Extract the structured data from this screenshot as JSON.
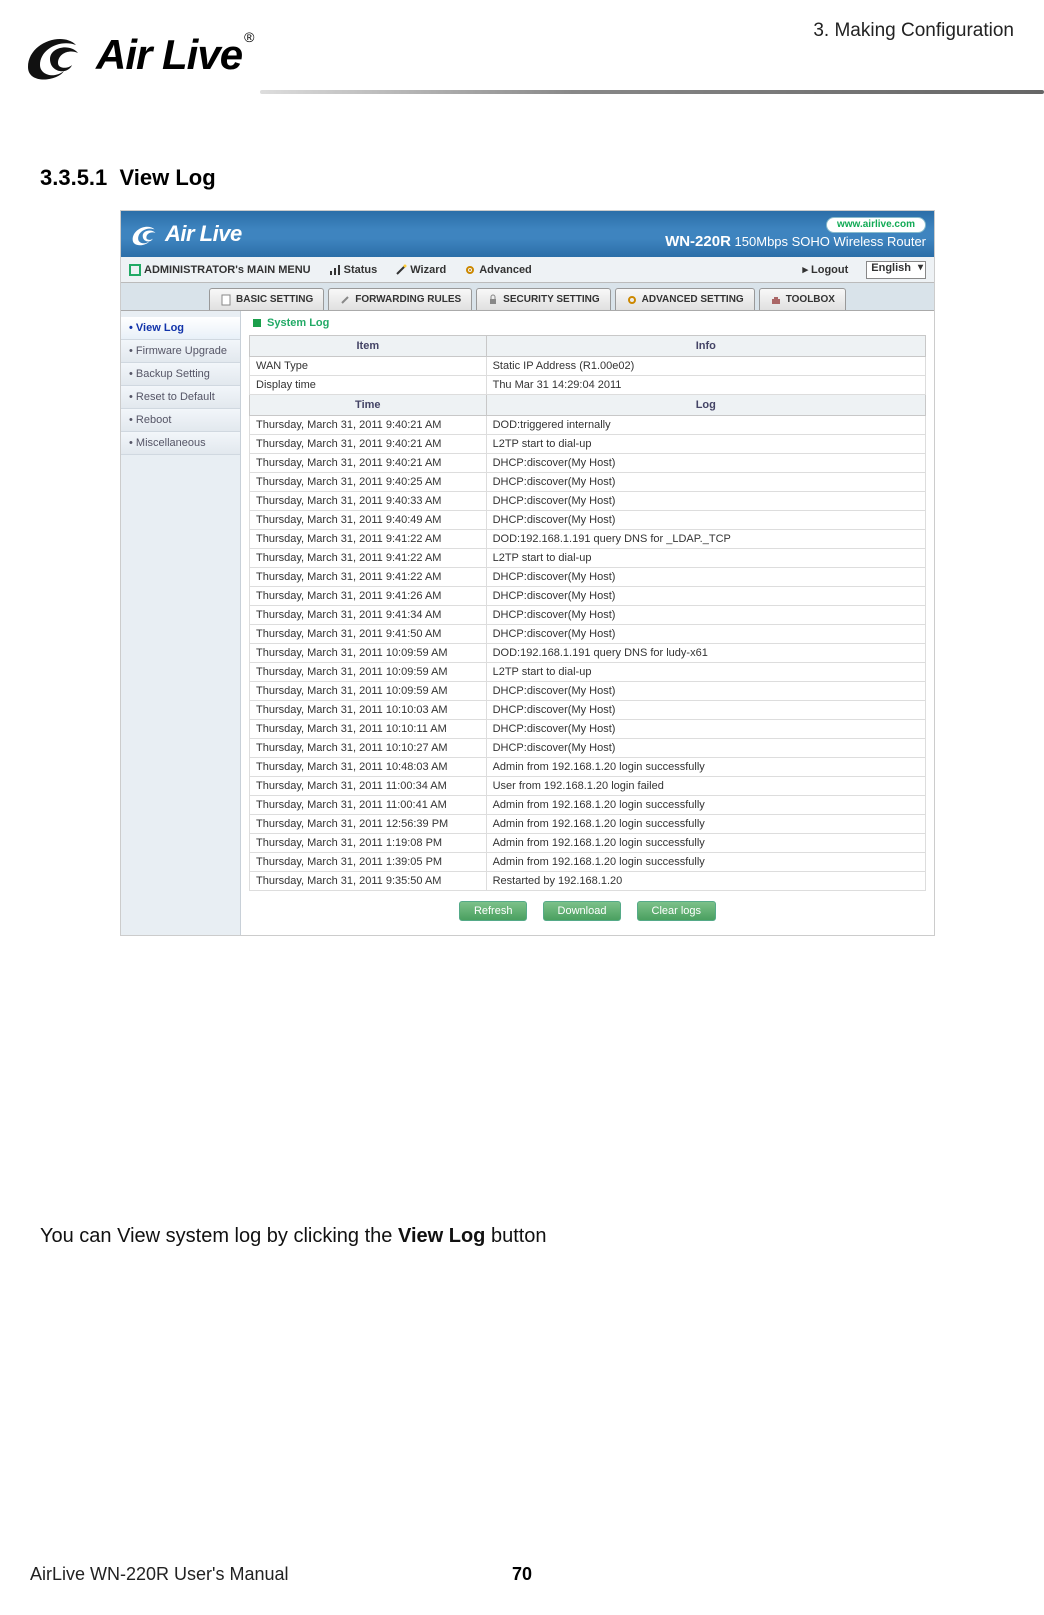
{
  "page": {
    "chapter": "3. Making Configuration",
    "brand": "Air Live",
    "section_number": "3.3.5.1",
    "section_title": "View Log",
    "note_prefix": "You can View system log by clicking the ",
    "note_bold": "View Log",
    "note_suffix": " button",
    "footer_manual": "AirLive WN-220R User's Manual",
    "footer_page": "70"
  },
  "ui": {
    "url_pill": "www.airlive.com",
    "model": "WN-220R",
    "model_desc": "150Mbps SOHO Wireless Router",
    "menubar": {
      "admin": "ADMINISTRATOR's MAIN MENU",
      "status": "Status",
      "wizard": "Wizard",
      "advanced": "Advanced",
      "logout": "Logout",
      "language": "English"
    },
    "tabs": [
      "BASIC SETTING",
      "FORWARDING RULES",
      "SECURITY SETTING",
      "ADVANCED SETTING",
      "TOOLBOX"
    ],
    "sidebar": [
      "View Log",
      "Firmware Upgrade",
      "Backup Setting",
      "Reset to Default",
      "Reboot",
      "Miscellaneous"
    ],
    "panel_title": "System Log",
    "headers": {
      "item": "Item",
      "info": "Info",
      "time": "Time",
      "log": "Log"
    },
    "info_rows": [
      {
        "item": "WAN Type",
        "info": "Static IP Address (R1.00e02)"
      },
      {
        "item": "Display time",
        "info": "Thu Mar 31 14:29:04 2011"
      }
    ],
    "log_rows": [
      {
        "time": "Thursday, March 31, 2011 9:40:21 AM",
        "log": "DOD:triggered internally"
      },
      {
        "time": "Thursday, March 31, 2011 9:40:21 AM",
        "log": "L2TP start to dial-up"
      },
      {
        "time": "Thursday, March 31, 2011 9:40:21 AM",
        "log": "DHCP:discover(My Host)"
      },
      {
        "time": "Thursday, March 31, 2011 9:40:25 AM",
        "log": "DHCP:discover(My Host)"
      },
      {
        "time": "Thursday, March 31, 2011 9:40:33 AM",
        "log": "DHCP:discover(My Host)"
      },
      {
        "time": "Thursday, March 31, 2011 9:40:49 AM",
        "log": "DHCP:discover(My Host)"
      },
      {
        "time": "Thursday, March 31, 2011 9:41:22 AM",
        "log": "DOD:192.168.1.191 query DNS for _LDAP._TCP"
      },
      {
        "time": "Thursday, March 31, 2011 9:41:22 AM",
        "log": "L2TP start to dial-up"
      },
      {
        "time": "Thursday, March 31, 2011 9:41:22 AM",
        "log": "DHCP:discover(My Host)"
      },
      {
        "time": "Thursday, March 31, 2011 9:41:26 AM",
        "log": "DHCP:discover(My Host)"
      },
      {
        "time": "Thursday, March 31, 2011 9:41:34 AM",
        "log": "DHCP:discover(My Host)"
      },
      {
        "time": "Thursday, March 31, 2011 9:41:50 AM",
        "log": "DHCP:discover(My Host)"
      },
      {
        "time": "Thursday, March 31, 2011 10:09:59 AM",
        "log": "DOD:192.168.1.191 query DNS for ludy-x61"
      },
      {
        "time": "Thursday, March 31, 2011 10:09:59 AM",
        "log": "L2TP start to dial-up"
      },
      {
        "time": "Thursday, March 31, 2011 10:09:59 AM",
        "log": "DHCP:discover(My Host)"
      },
      {
        "time": "Thursday, March 31, 2011 10:10:03 AM",
        "log": "DHCP:discover(My Host)"
      },
      {
        "time": "Thursday, March 31, 2011 10:10:11 AM",
        "log": "DHCP:discover(My Host)"
      },
      {
        "time": "Thursday, March 31, 2011 10:10:27 AM",
        "log": "DHCP:discover(My Host)"
      },
      {
        "time": "Thursday, March 31, 2011 10:48:03 AM",
        "log": "Admin from 192.168.1.20 login successfully"
      },
      {
        "time": "Thursday, March 31, 2011 11:00:34 AM",
        "log": "User from 192.168.1.20 login failed"
      },
      {
        "time": "Thursday, March 31, 2011 11:00:41 AM",
        "log": "Admin from 192.168.1.20 login successfully"
      },
      {
        "time": "Thursday, March 31, 2011 12:56:39 PM",
        "log": "Admin from 192.168.1.20 login successfully"
      },
      {
        "time": "Thursday, March 31, 2011 1:19:08 PM",
        "log": "Admin from 192.168.1.20 login successfully"
      },
      {
        "time": "Thursday, March 31, 2011 1:39:05 PM",
        "log": "Admin from 192.168.1.20 login successfully"
      },
      {
        "time": "Thursday, March 31, 2011 9:35:50 AM",
        "log": "Restarted by 192.168.1.20"
      }
    ],
    "buttons": {
      "refresh": "Refresh",
      "download": "Download",
      "clear": "Clear logs"
    }
  }
}
